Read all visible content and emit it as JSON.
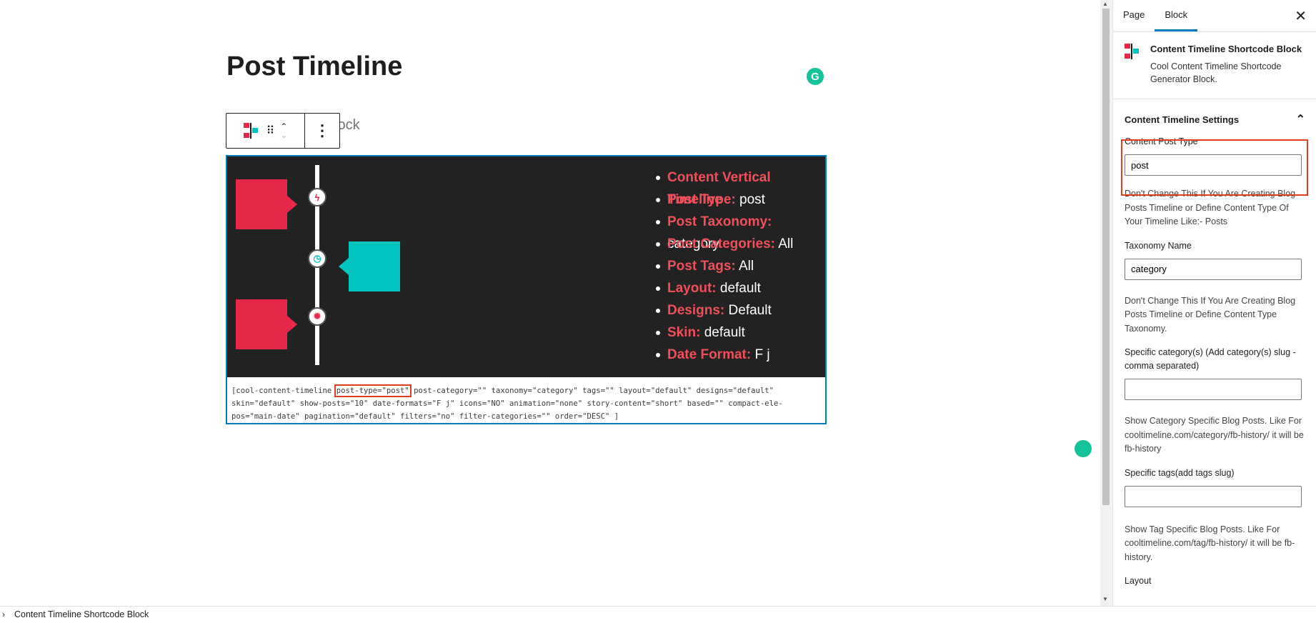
{
  "editor": {
    "post_title": "Post Timeline",
    "placeholder_fragment": "lock",
    "grammarly_letter": "G"
  },
  "toolbar": {
    "drag_glyph": "⠿",
    "move_up": "⌃",
    "move_down": "⌄",
    "more_glyph": "⋮"
  },
  "preview": {
    "bullets": [
      {
        "label": "Content Vertical Timeline",
        "value": ""
      },
      {
        "label": "Post Type:",
        "value": " post"
      },
      {
        "label": "Post Taxonomy:",
        "value": " category"
      },
      {
        "label": "Post Categories:",
        "value": " All"
      },
      {
        "label": "Post Tags:",
        "value": " All"
      },
      {
        "label": "Layout:",
        "value": " default"
      },
      {
        "label": "Designs:",
        "value": " Default"
      },
      {
        "label": "Skin:",
        "value": " default"
      },
      {
        "label": "Date Format:",
        "value": " F j"
      }
    ],
    "timeline_icons": [
      "bolt-icon",
      "clock-icon",
      "gear-icon"
    ]
  },
  "shortcode": {
    "prefix": "[cool-content-timeline ",
    "highlighted": "post-type=\"post\"",
    "rest": " post-category=\"\" taxonomy=\"category\" tags=\"\" layout=\"default\" designs=\"default\" skin=\"default\" show-posts=\"10\" date-formats=\"F j\" icons=\"NO\" animation=\"none\" story-content=\"short\" based=\"\" compact-ele-pos=\"main-date\" pagination=\"default\" filters=\"no\" filter-categories=\"\" order=\"DESC\" ]"
  },
  "sidebar": {
    "tabs": [
      {
        "label": "Page"
      },
      {
        "label": "Block"
      }
    ],
    "close_glyph": "✕",
    "block_card": {
      "title": "Content Timeline Shortcode Block",
      "description": "Cool Content Timeline Shortcode Generator Block."
    },
    "panel": {
      "title": "Content Timeline Settings",
      "toggle_glyph": "⌃",
      "fields": [
        {
          "label": "Content Post Type",
          "value": "post",
          "help": "Don't Change This If You Are Creating Blog Posts Timeline or Define Content Type Of Your Timeline Like:- Posts"
        },
        {
          "label": "Taxonomy Name",
          "value": "category",
          "help": "Don't Change This If You Are Creating Blog Posts Timeline or Define Content Type Taxonomy."
        },
        {
          "label": "Specific category(s) (Add category(s) slug - comma separated)",
          "value": "",
          "help": "Show Category Specific Blog Posts. Like For cooltimeline.com/category/fb-history/ it will be fb-history"
        },
        {
          "label": "Specific tags(add tags slug)",
          "value": "",
          "help": "Show Tag Specific Blog Posts. Like For cooltimeline.com/tag/fb-history/ it will be fb-history."
        },
        {
          "label": "Layout"
        }
      ]
    }
  },
  "footer": {
    "chevron": "›",
    "breadcrumb": "Content Timeline Shortcode Block"
  },
  "colors": {
    "accent": "#007cba",
    "timeline_red": "#e8284a",
    "timeline_teal": "#00c3bf",
    "highlight": "#e03c1f",
    "grammarly": "#15c39a"
  }
}
